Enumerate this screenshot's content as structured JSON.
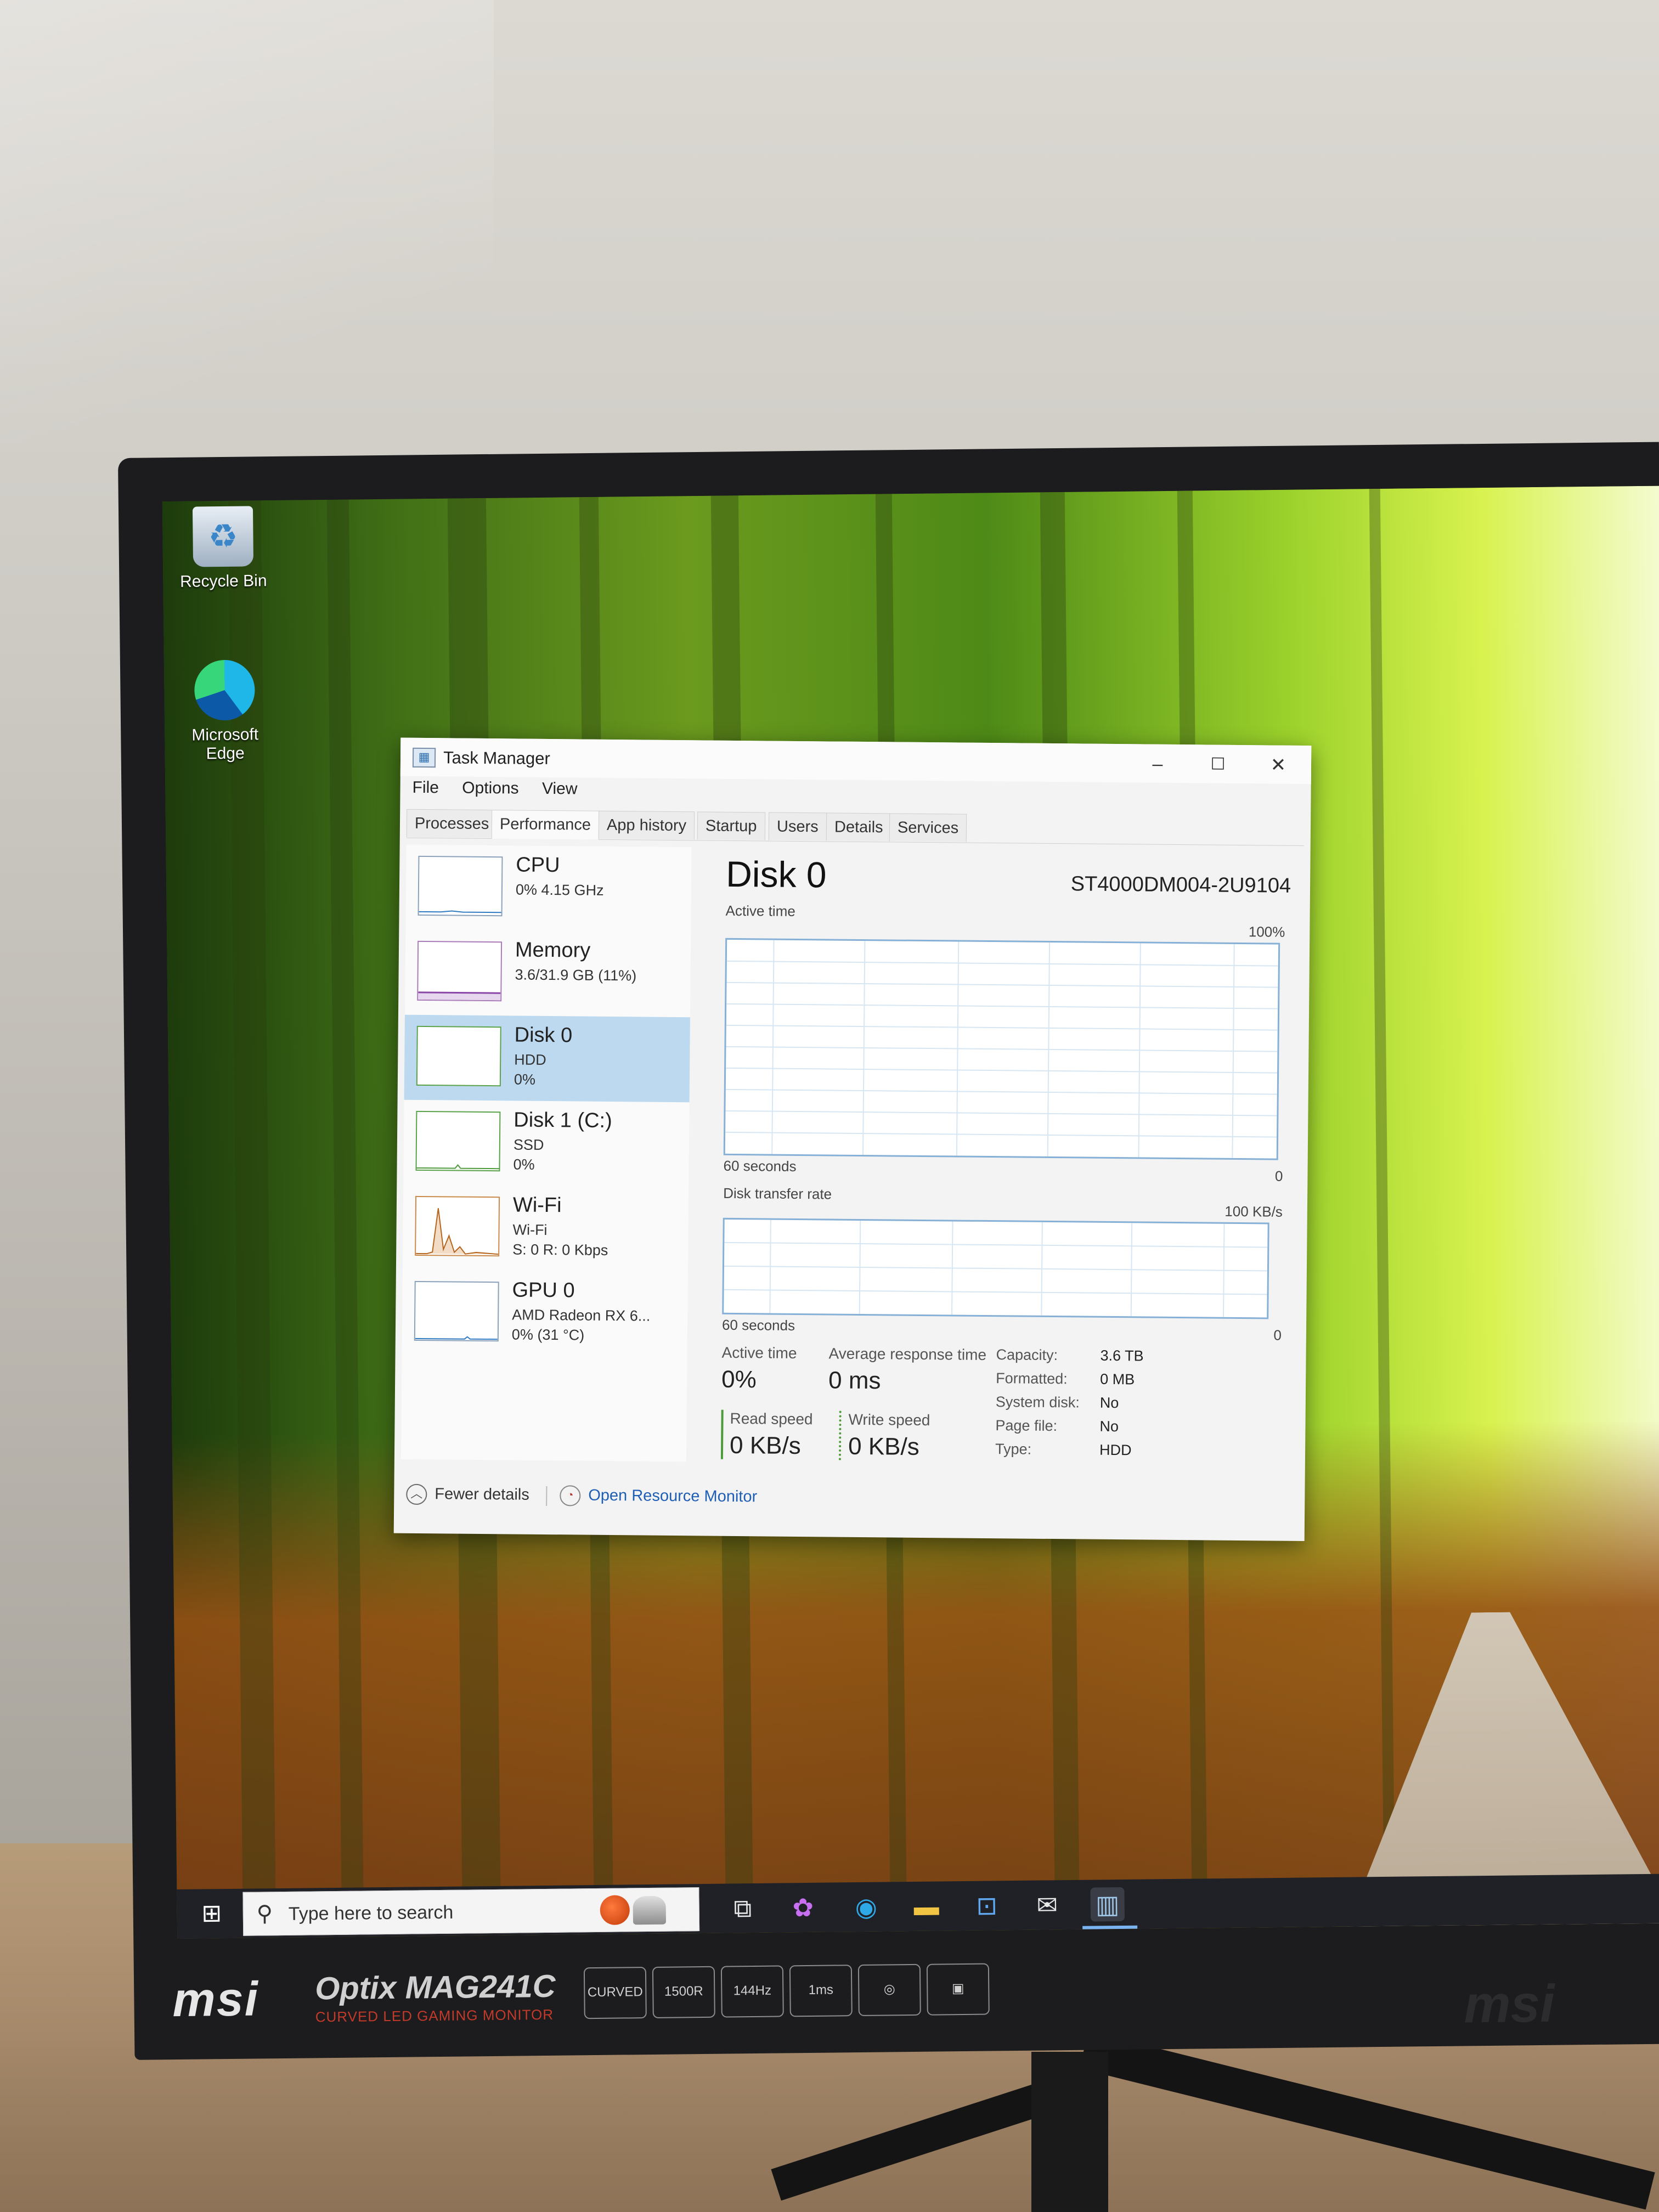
{
  "desktop": {
    "icons": [
      {
        "label": "Recycle Bin"
      },
      {
        "label": "Microsoft Edge"
      }
    ]
  },
  "task_manager": {
    "title": "Task Manager",
    "menu": [
      "File",
      "Options",
      "View"
    ],
    "tabs": [
      "Processes",
      "Performance",
      "App history",
      "Startup",
      "Users",
      "Details",
      "Services"
    ],
    "active_tab": "Performance",
    "sidebar": [
      {
        "name": "CPU",
        "sub1": "0% 4.15 GHz",
        "sub2": "",
        "sub3": ""
      },
      {
        "name": "Memory",
        "sub1": "3.6/31.9 GB (11%)",
        "sub2": "",
        "sub3": ""
      },
      {
        "name": "Disk 0",
        "sub1": "HDD",
        "sub2": "0%",
        "sub3": "",
        "selected": true
      },
      {
        "name": "Disk 1 (C:)",
        "sub1": "SSD",
        "sub2": "0%",
        "sub3": ""
      },
      {
        "name": "Wi-Fi",
        "sub1": "Wi-Fi",
        "sub2": "S: 0 R: 0 Kbps",
        "sub3": ""
      },
      {
        "name": "GPU 0",
        "sub1": "AMD Radeon RX 6...",
        "sub2": "0% (31 °C)",
        "sub3": ""
      }
    ],
    "detail": {
      "title": "Disk 0",
      "model": "ST4000DM004-2U9104",
      "active_time_label": "Active time",
      "active_time_max": "100%",
      "graph1_time": "60 seconds",
      "graph1_min": "0",
      "transfer_label": "Disk transfer rate",
      "transfer_max": "100 KB/s",
      "graph2_time": "60 seconds",
      "graph2_min": "0",
      "stats": {
        "active_time_label": "Active time",
        "active_time_value": "0%",
        "avg_resp_label": "Average response time",
        "avg_resp_value": "0 ms",
        "read_label": "Read speed",
        "read_value": "0 KB/s",
        "write_label": "Write speed",
        "write_value": "0 KB/s"
      },
      "properties": [
        {
          "key": "Capacity:",
          "value": "3.6 TB"
        },
        {
          "key": "Formatted:",
          "value": "0 MB"
        },
        {
          "key": "System disk:",
          "value": "No"
        },
        {
          "key": "Page file:",
          "value": "No"
        },
        {
          "key": "Type:",
          "value": "HDD"
        }
      ]
    },
    "footer": {
      "fewer_details": "Fewer details",
      "open_resource_monitor": "Open Resource Monitor"
    }
  },
  "taskbar": {
    "search_placeholder": "Type here to search"
  },
  "bezel": {
    "brand": "msi",
    "model": "Optix MAG241C",
    "model_sub": "CURVED LED GAMING MONITOR",
    "features": [
      "CURVED",
      "1500R",
      "144Hz",
      "1ms",
      "",
      ""
    ]
  },
  "colors": {
    "selection": "#bcd9ef",
    "graph_border": "#86b0d6",
    "link": "#1f5eb5",
    "taskbar": "#1f2127"
  }
}
